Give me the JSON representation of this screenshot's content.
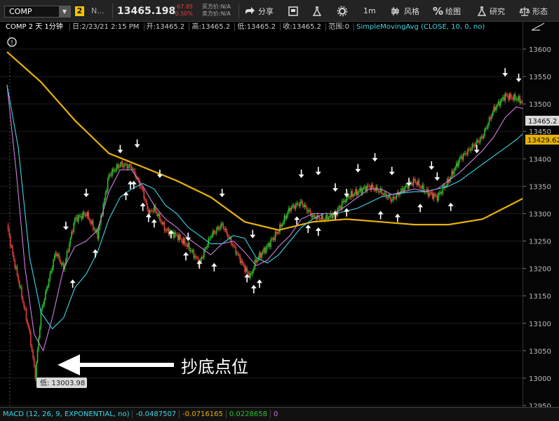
{
  "toolbar": {
    "symbol": "COMP",
    "link_badge": "2",
    "name_abbrev": "N...",
    "last_price": "13465.198",
    "net_change": "-67.85",
    "pct_change": "-0.50%",
    "bid_label": "买方价:N/A",
    "ask_label": "卖方价:N/A",
    "share_label": "分享",
    "timeframe_label": "1m",
    "style_label": "风格",
    "draw_label": "绘图",
    "studies_label": "研究",
    "patterns_label": "形态"
  },
  "info_bar": {
    "title": "COMP 2 天 1分钟",
    "date": "日:2/23/21 2:15 PM",
    "open": "开:13465.2",
    "high": "高:13465.2",
    "low": "低:13465.2",
    "close": "收:13465.2",
    "range": "范围:0",
    "study": "SimpleMovingAvg (CLOSE, 10, 0, no)"
  },
  "annotation": {
    "text": "抄底点位",
    "low_label": "低: 13003.98"
  },
  "price_axis": {
    "ticks": [
      12950,
      13000,
      13050,
      13100,
      13150,
      13200,
      13250,
      13300,
      13350,
      13400,
      13450,
      13500,
      13550,
      13600
    ],
    "last_label": "13465.2",
    "ma_label": "13429.62"
  },
  "macd_bar": {
    "label": "MACD (12, 26, 9, EXPONENTIAL, no)",
    "value": "-0.0487507",
    "avg": "-0.0716165",
    "diff": "0.0228658",
    "zero": "0"
  },
  "colors": {
    "up": "#2fbf2f",
    "down": "#e0413a",
    "ma_slow": "#e7b10a",
    "ma_cyan": "#3fd6e6",
    "ma_violet": "#d07de0",
    "macd_value": "#3fd6e6",
    "macd_avg": "#e7b10a",
    "macd_diff": "#2fbf2f",
    "macd_zero": "#d07de0"
  },
  "chart_data": {
    "type": "line",
    "ylim": [
      12950,
      13600
    ],
    "close_path": {
      "x_bar_index": [
        0,
        5,
        12,
        20,
        25,
        30,
        37,
        43,
        50,
        60,
        70,
        80,
        90,
        100,
        110,
        120,
        125,
        130,
        140,
        150,
        160,
        170,
        180,
        190,
        200,
        210,
        215,
        220,
        230,
        240,
        250,
        260,
        270,
        280,
        290,
        300,
        310,
        320,
        330,
        340,
        350,
        360,
        370,
        380,
        390,
        400,
        410,
        420,
        430,
        440,
        450,
        458
      ],
      "price": [
        13280,
        13225,
        13160,
        13080,
        13004,
        13120,
        13180,
        13230,
        13200,
        13290,
        13300,
        13260,
        13370,
        13390,
        13385,
        13340,
        13300,
        13310,
        13270,
        13260,
        13240,
        13210,
        13260,
        13280,
        13240,
        13200,
        13185,
        13215,
        13240,
        13270,
        13310,
        13320,
        13295,
        13290,
        13300,
        13330,
        13340,
        13350,
        13340,
        13325,
        13345,
        13360,
        13340,
        13330,
        13360,
        13400,
        13420,
        13440,
        13490,
        13515,
        13510,
        13500
      ]
    },
    "sma_slow_points": {
      "x_bar_index": [
        0,
        30,
        60,
        90,
        120,
        150,
        180,
        210,
        240,
        270,
        300,
        330,
        360,
        390,
        420,
        458
      ],
      "price": [
        13595,
        13540,
        13470,
        13410,
        13385,
        13360,
        13330,
        13285,
        13270,
        13285,
        13290,
        13285,
        13280,
        13280,
        13290,
        13330
      ]
    },
    "sma_cyan_points": {
      "x_bar_index": [
        0,
        10,
        20,
        30,
        40,
        50,
        60,
        70,
        80,
        90,
        100,
        110,
        120,
        130,
        140,
        150,
        160,
        170,
        180,
        190,
        200,
        210,
        220,
        230,
        240,
        250,
        260,
        270,
        280,
        290,
        300,
        310,
        320,
        330,
        340,
        350,
        360,
        370,
        380,
        390,
        400,
        410,
        420,
        430,
        440,
        450,
        458
      ],
      "price": [
        13535,
        13420,
        13220,
        13120,
        13090,
        13110,
        13165,
        13190,
        13230,
        13290,
        13330,
        13345,
        13355,
        13345,
        13315,
        13300,
        13275,
        13260,
        13245,
        13245,
        13260,
        13255,
        13220,
        13210,
        13225,
        13250,
        13275,
        13290,
        13300,
        13300,
        13305,
        13310,
        13320,
        13330,
        13335,
        13338,
        13340,
        13340,
        13345,
        13350,
        13360,
        13375,
        13390,
        13405,
        13420,
        13435,
        13450
      ]
    },
    "sma_violet_points": {
      "x_bar_index": [
        0,
        8,
        16,
        24,
        32,
        40,
        50,
        60,
        70,
        80,
        90,
        100,
        110,
        120,
        130,
        140,
        150,
        160,
        170,
        180,
        190,
        200,
        210,
        220,
        230,
        240,
        250,
        260,
        270,
        280,
        290,
        300,
        310,
        320,
        330,
        340,
        350,
        360,
        370,
        380,
        390,
        400,
        410,
        420,
        430,
        440,
        450,
        458
      ],
      "price": [
        13535,
        13380,
        13200,
        13080,
        13050,
        13110,
        13200,
        13240,
        13250,
        13270,
        13340,
        13380,
        13380,
        13350,
        13315,
        13290,
        13275,
        13255,
        13240,
        13225,
        13245,
        13250,
        13230,
        13205,
        13215,
        13240,
        13260,
        13290,
        13300,
        13300,
        13300,
        13315,
        13330,
        13345,
        13345,
        13335,
        13340,
        13345,
        13340,
        13345,
        13360,
        13375,
        13395,
        13415,
        13440,
        13475,
        13495,
        13490
      ]
    },
    "down_arrow_points": {
      "x_bar_index": [
        52,
        70,
        100,
        115,
        135,
        160,
        190,
        217,
        260,
        275,
        290,
        300,
        310,
        325,
        340,
        355,
        375,
        380,
        415,
        440,
        452
      ],
      "price": [
        13270,
        13330,
        13410,
        13420,
        13365,
        13250,
        13330,
        13255,
        13365,
        13370,
        13340,
        13330,
        13375,
        13395,
        13370,
        13350,
        13380,
        13360,
        13410,
        13550,
        13540
      ]
    },
    "up_arrow_points": {
      "x_bar_index": [
        58,
        78,
        105,
        109,
        112,
        120,
        125,
        130,
        145,
        158,
        170,
        183,
        212,
        218,
        223,
        256,
        266,
        275,
        290,
        300,
        330,
        345,
        365,
        392
      ],
      "price": [
        13180,
        13235,
        13340,
        13360,
        13360,
        13320,
        13300,
        13290,
        13270,
        13230,
        13215,
        13210,
        13190,
        13170,
        13180,
        13295,
        13280,
        13275,
        13305,
        13310,
        13305,
        13300,
        13318,
        13320
      ]
    }
  }
}
